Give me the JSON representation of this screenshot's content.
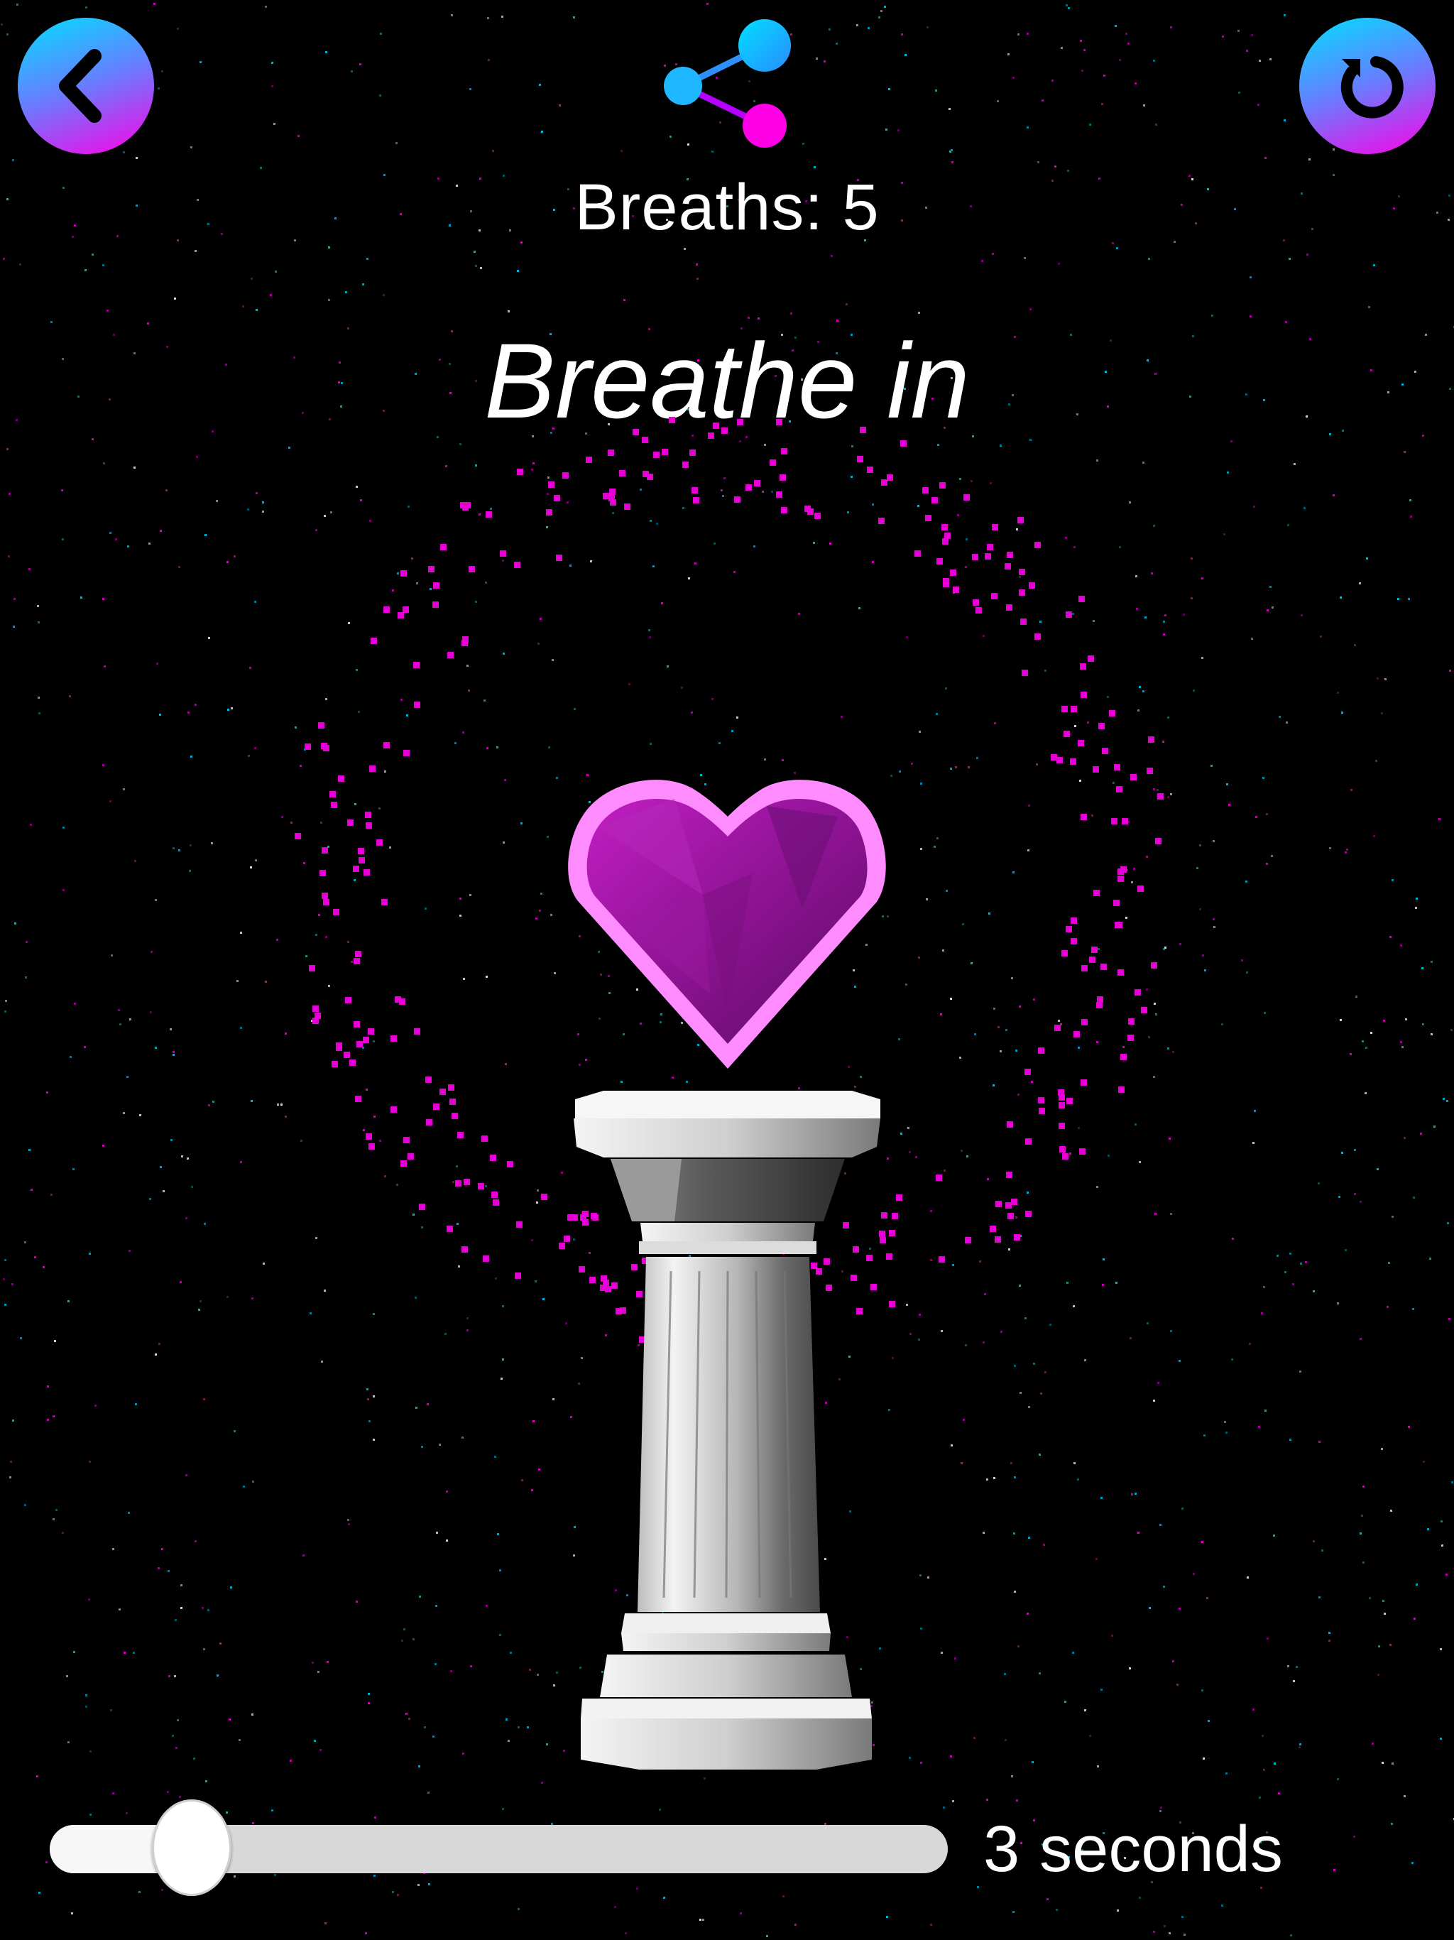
{
  "header": {
    "back_icon": "chevron-left-icon",
    "share_icon": "share-icon",
    "restart_icon": "restart-icon",
    "breaths_label": "Breaths:",
    "breaths_count": "5"
  },
  "main": {
    "instruction": "Breathe in",
    "heart_icon": "heart-icon"
  },
  "duration": {
    "value": "3",
    "unit": "seconds",
    "slider_fraction": 0.158
  },
  "colors": {
    "background": "#000000",
    "accent_cyan": "#00e0ff",
    "accent_magenta": "#ff00e6",
    "particle": "#e600d6"
  }
}
